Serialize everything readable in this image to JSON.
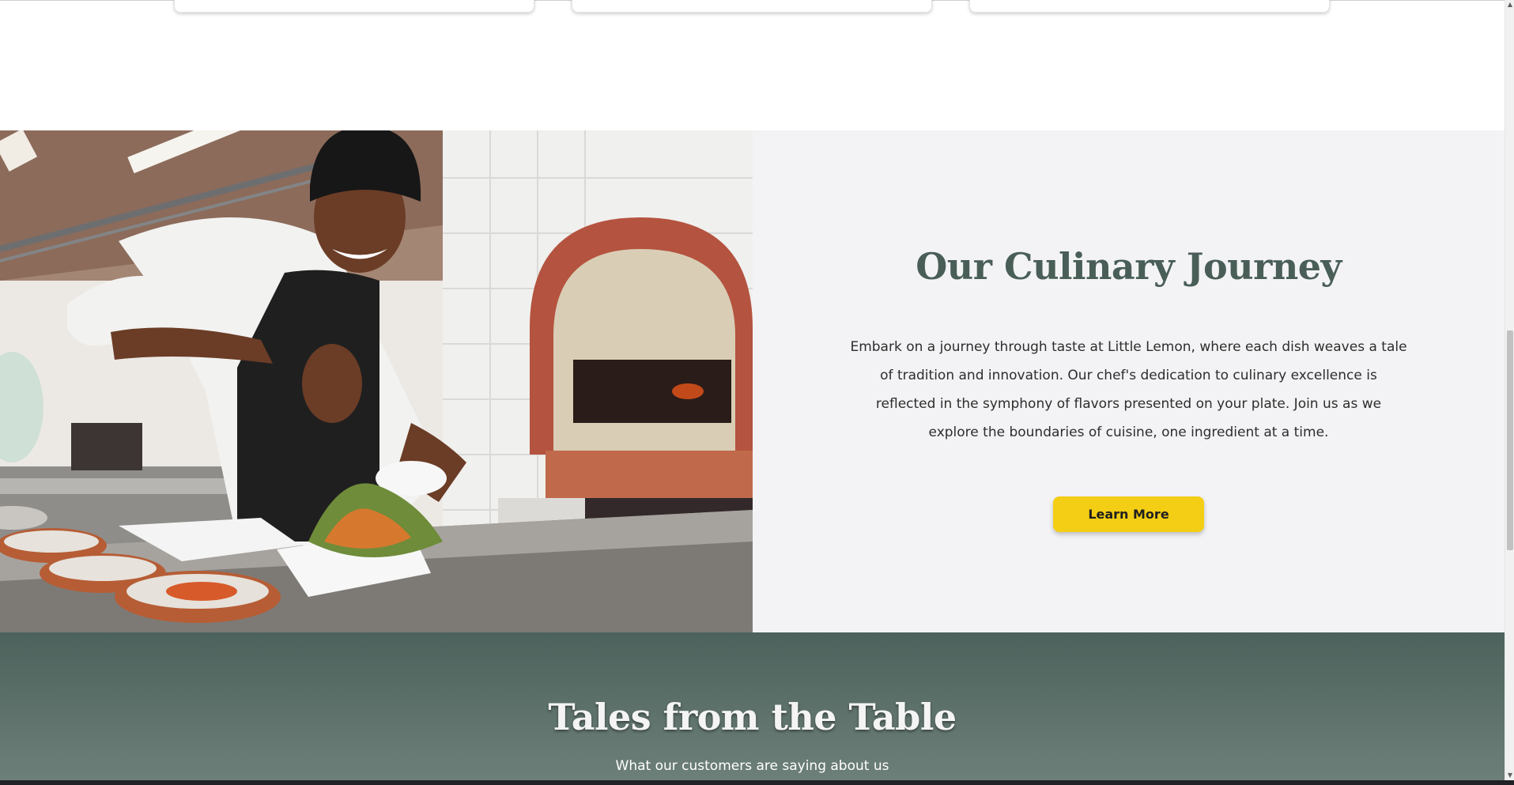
{
  "culinary": {
    "image_alt": "Chef garnishing a salad in a restaurant kitchen",
    "heading": "Our Culinary Journey",
    "body": "Embark on a journey through taste at Little Lemon, where each dish weaves a tale of tradition and innovation. Our chef's dedication to culinary excellence is reflected in the symphony of flavors presented on your plate. Join us as we explore the boundaries of cuisine, one ingredient at a time.",
    "button_label": "Learn More"
  },
  "testimonials": {
    "heading": "Tales from the Table",
    "subheading": "What our customers are saying about us"
  },
  "scrollbar": {
    "up_icon": "▲",
    "down_icon": "▼"
  },
  "colors": {
    "brand_green": "#495e57",
    "brand_yellow": "#f4ce14",
    "panel_bg": "#f3f3f5"
  }
}
